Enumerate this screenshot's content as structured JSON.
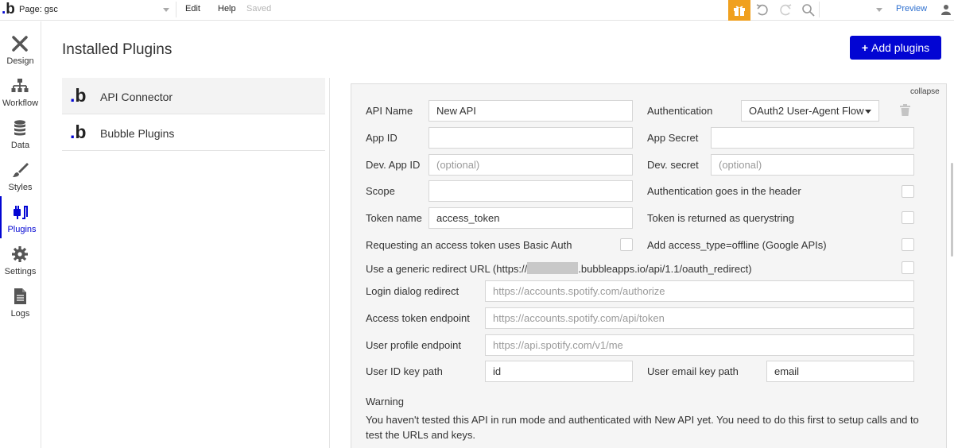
{
  "topbar": {
    "logo_letter": "b",
    "logo_dot": ".",
    "page_label": "Page: gsc",
    "menu": {
      "edit": "Edit",
      "help": "Help",
      "saved": "Saved"
    },
    "preview": "Preview"
  },
  "sidebar": {
    "items": [
      {
        "label": "Design",
        "icon": "design-icon"
      },
      {
        "label": "Workflow",
        "icon": "workflow-icon"
      },
      {
        "label": "Data",
        "icon": "database-icon"
      },
      {
        "label": "Styles",
        "icon": "brush-icon"
      },
      {
        "label": "Plugins",
        "icon": "plug-icon",
        "active": true
      },
      {
        "label": "Settings",
        "icon": "gear-icon"
      },
      {
        "label": "Logs",
        "icon": "document-icon"
      }
    ]
  },
  "main": {
    "title": "Installed Plugins",
    "add_button": "Add plugins",
    "plugins": [
      {
        "name": "API Connector",
        "selected": true
      },
      {
        "name": "Bubble Plugins",
        "selected": false
      }
    ]
  },
  "panel": {
    "collapse": "collapse",
    "api_name_label": "API Name",
    "api_name_value": "New API",
    "authentication_label": "Authentication",
    "authentication_value": "OAuth2 User-Agent Flow",
    "app_id_label": "App ID",
    "app_id_value": "",
    "app_secret_label": "App Secret",
    "app_secret_value": "",
    "dev_app_id_label": "Dev. App ID",
    "dev_app_id_placeholder": "(optional)",
    "dev_secret_label": "Dev. secret",
    "dev_secret_placeholder": "(optional)",
    "scope_label": "Scope",
    "scope_value": "",
    "auth_header_label": "Authentication goes in the header",
    "token_name_label": "Token name",
    "token_name_value": "access_token",
    "token_querystring_label": "Token is returned as querystring",
    "basic_auth_label": "Requesting an access token uses Basic Auth",
    "offline_label": "Add access_type=offline (Google APIs)",
    "redirect_label_prefix": "Use a generic redirect URL (https://",
    "redirect_label_suffix": ".bubbleapps.io/api/1.1/oauth_redirect)",
    "login_dialog_label": "Login dialog redirect",
    "login_dialog_value": "https://accounts.spotify.com/authorize",
    "access_token_endpoint_label": "Access token endpoint",
    "access_token_endpoint_value": "https://accounts.spotify.com/api/token",
    "user_profile_endpoint_label": "User profile endpoint",
    "user_profile_endpoint_value": "https://api.spotify.com/v1/me",
    "user_id_key_path_label": "User ID key path",
    "user_id_key_path_value": "id",
    "user_email_key_path_label": "User email key path",
    "user_email_key_path_value": "email",
    "warning_title": "Warning",
    "warning_text": "You haven't tested this API in run mode and authenticated with New API yet. You need to do this first to setup calls and to test the URLs and keys."
  },
  "colors": {
    "accent": "#0205d3",
    "gift": "#f0a01e",
    "link": "#2d6fcf"
  }
}
